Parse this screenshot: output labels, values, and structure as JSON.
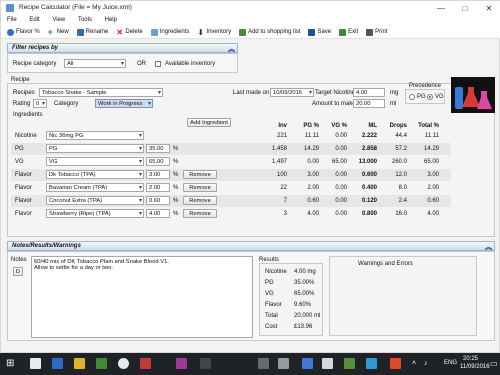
{
  "window": {
    "title": "Recipe Calculator (File = My Juice.xml)",
    "minimize": "—",
    "maximize": "□",
    "close": "✕"
  },
  "menu": [
    "File",
    "Edit",
    "View",
    "Tools",
    "Help"
  ],
  "toolbar": {
    "flavor": "Flavor %",
    "new": "New",
    "rename": "Rename",
    "delete": "Delete",
    "ingredients": "Ingredients",
    "inventory": "Inventory",
    "shopping": "Add to shopping list",
    "save": "Save",
    "exit": "Exit",
    "print": "Print"
  },
  "filter": {
    "header": "Filter recipes by",
    "category_label": "Recipe category",
    "category_value": "All",
    "or": "OR",
    "available_label": "Available inventory",
    "collapse": "︽"
  },
  "recipe": {
    "section": "Recipe",
    "recipes_label": "Recipes",
    "recipe_value": "Tobacco Snake - Sample",
    "rating_label": "Rating",
    "rating_value": "0",
    "category_label": "Category",
    "category_value": "Work in Progress",
    "last_made_label": "Last made on",
    "last_made_value": "10/09/2016",
    "target_nicotine_label": "Target Nicotine",
    "target_nicotine_value": "4.00",
    "nicotine_unit": "mg",
    "amount_label": "Amount to make",
    "amount_value": "20.00",
    "amount_unit": "ml",
    "precedence_label": "Precedence",
    "pg_option": "PG",
    "vg_option": "VG",
    "precedence_selected": "VG"
  },
  "ingredients": {
    "section": "Ingredients",
    "add_button": "Add Ingredient",
    "headers": {
      "inv": "Inv",
      "pg": "PG %",
      "vg": "VG %",
      "ml": "ML",
      "drops": "Drops",
      "total": "Total %"
    },
    "rows": [
      {
        "type": "Nicotine",
        "name": "Nic 36mg PG",
        "pct": "",
        "unit": "",
        "remove": "",
        "inv": "221",
        "pg": "11.11",
        "vg": "0.00",
        "ml": "2.222",
        "drops": "44.4",
        "total": "11.11"
      },
      {
        "type": "PG",
        "name": "PG",
        "pct": "35.00",
        "unit": "%",
        "remove": "",
        "inv": "1,458",
        "pg": "14.29",
        "vg": "0.00",
        "ml": "2.858",
        "drops": "57.2",
        "total": "14.29"
      },
      {
        "type": "VG",
        "name": "VG",
        "pct": "65.00",
        "unit": "%",
        "remove": "",
        "inv": "1,497",
        "pg": "0.00",
        "vg": "65.00",
        "ml": "13.000",
        "drops": "260.0",
        "total": "65.00"
      },
      {
        "type": "Flavor",
        "name": "Dk Tobacco (TPA)",
        "pct": "3.00",
        "unit": "%",
        "remove": "Remove",
        "inv": "100",
        "pg": "3.00",
        "vg": "0.00",
        "ml": "0.600",
        "drops": "12.0",
        "total": "3.00"
      },
      {
        "type": "Flavor",
        "name": "Bavarian Cream (TPA)",
        "pct": "2.00",
        "unit": "%",
        "remove": "Remove",
        "inv": "22",
        "pg": "2.00",
        "vg": "0.00",
        "ml": "0.400",
        "drops": "8.0",
        "total": "2.00"
      },
      {
        "type": "Flavor",
        "name": "Coconut Extra (TPA)",
        "pct": "0.60",
        "unit": "%",
        "remove": "Remove",
        "inv": "7",
        "pg": "0.60",
        "vg": "0.00",
        "ml": "0.120",
        "drops": "2.4",
        "total": "0.60"
      },
      {
        "type": "Flavor",
        "name": "Strawberry (Ripe) (TPA)",
        "pct": "4.00",
        "unit": "%",
        "remove": "Remove",
        "inv": "3",
        "pg": "4.00",
        "vg": "0.00",
        "ml": "0.800",
        "drops": "16.0",
        "total": "4.00"
      }
    ]
  },
  "notes": {
    "header": "Notes/Results/Warnings",
    "notes_label": "Notes",
    "d_button": "D",
    "text_line1": "60/40 mix of DK Tobacco Plain and Snake Blood V1.",
    "text_line2": "Allow to settle for a day or two.",
    "results_label": "Results",
    "results": [
      {
        "label": "Nicotine",
        "value": "4.00 mg"
      },
      {
        "label": "PG",
        "value": "35.00%"
      },
      {
        "label": "VG",
        "value": "65.00%"
      },
      {
        "label": "Flavor",
        "value": "9.60%"
      },
      {
        "label": "Total",
        "value": "20.000 ml"
      },
      {
        "label": "Cost",
        "value": "£13.96"
      }
    ],
    "warnings_label": "Warnings and Errors"
  },
  "taskbar": {
    "lang": "ENG",
    "time": "20:25",
    "date": "11/09/2016"
  },
  "colors": {
    "accent": "#1e5bbf",
    "panel_header": "#cfdcf0",
    "category_highlight": "#c9dcf3"
  }
}
